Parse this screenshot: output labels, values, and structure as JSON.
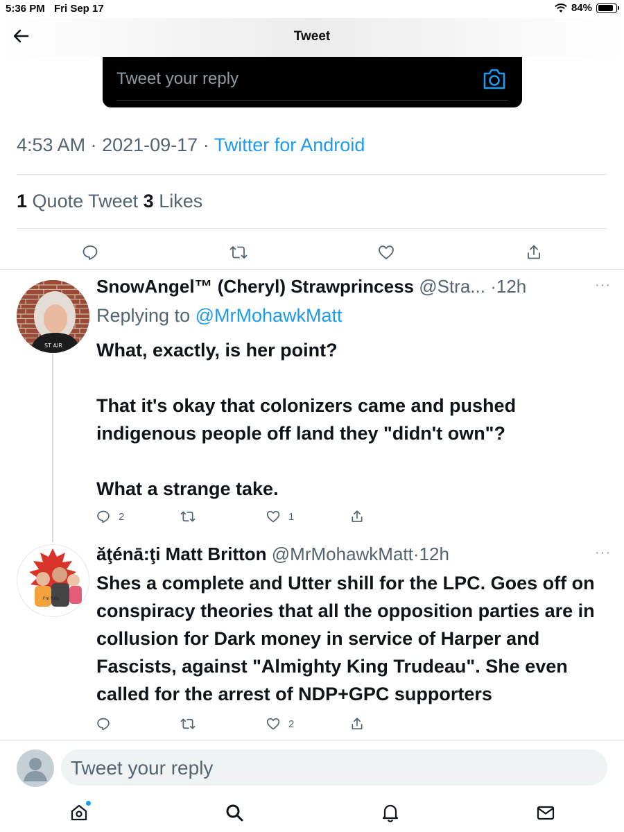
{
  "status_bar": {
    "time": "5:36 PM",
    "date": "Fri Sep 17",
    "battery_percent": "84%",
    "battery_level": 0.84,
    "wifi_icon": "wifi-icon"
  },
  "header": {
    "title": "Tweet",
    "back_icon": "arrow-left-icon"
  },
  "top_reply": {
    "placeholder": "Tweet your reply",
    "camera_icon": "camera-icon"
  },
  "main_tweet": {
    "time": "4:53 AM",
    "date": "2021-09-17",
    "source": "Twitter for Android",
    "quote_count": "1",
    "quote_label": "Quote Tweet",
    "like_count": "3",
    "like_label": "Likes"
  },
  "replies": [
    {
      "name": "SnowAngel™ (Cheryl) Strawprincess",
      "handle": "@Stra...",
      "time": "·12h",
      "replying_prefix": "Replying to",
      "replying_to": "@MrMohawkMatt",
      "text_lines": [
        "What, exactly, is her point?",
        "That it's okay that colonizers came and pushed indigenous people off land they \"didn't own\"?",
        "What a strange take."
      ],
      "reply_count": "2",
      "retweet_count": "",
      "like_count": "1"
    },
    {
      "name": "ăţénā:ţi Matt Britton",
      "handle": "@MrMohawkMatt",
      "time": "·12h",
      "text": "Shes a complete and Utter shill for the LPC. Goes off on conspiracy theories that all the opposition parties are in collusion for Dark money in service of Harper and Fascists, against \"Almighty King Trudeau\". She even called for the arrest of NDP+GPC supporters",
      "reply_count": "",
      "retweet_count": "",
      "like_count": "2"
    }
  ],
  "bottom_reply": {
    "placeholder": "Tweet your reply"
  },
  "tabbar": {
    "items": [
      "home-icon",
      "search-icon",
      "notifications-icon",
      "messages-icon"
    ]
  },
  "colors": {
    "accent": "#1d9bf0",
    "secondary_text": "#536471",
    "primary_text": "#0f1419",
    "divider": "#e1e6ea"
  }
}
